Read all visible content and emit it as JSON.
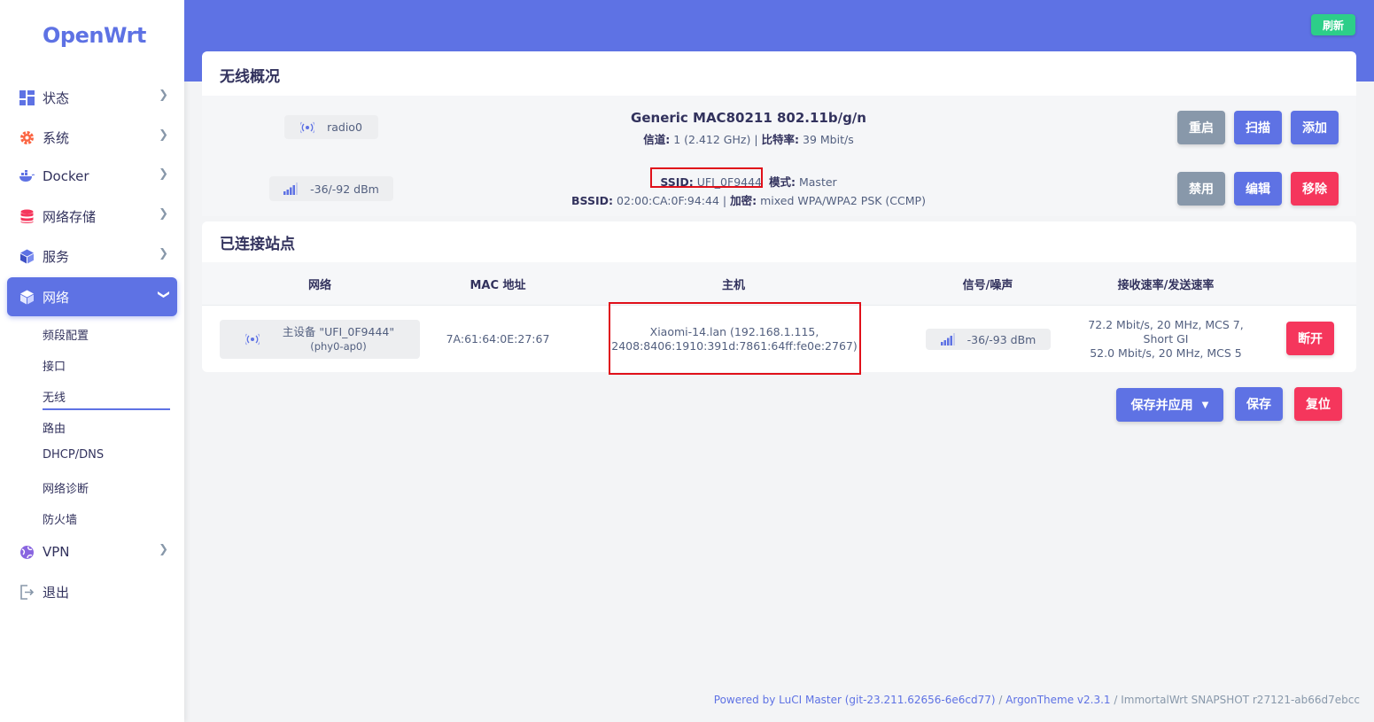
{
  "brand": "OpenWrt",
  "sidebar": {
    "items": [
      {
        "label": "状态",
        "icon": "dashboard-icon"
      },
      {
        "label": "系统",
        "icon": "gear-icon"
      },
      {
        "label": "Docker",
        "icon": "docker-icon"
      },
      {
        "label": "网络存储",
        "icon": "database-icon"
      },
      {
        "label": "服务",
        "icon": "cube-icon"
      },
      {
        "label": "网络",
        "icon": "cube-icon"
      },
      {
        "label": "VPN",
        "icon": "globe-icon"
      },
      {
        "label": "退出",
        "icon": "logout-icon"
      }
    ],
    "submenu": [
      "频段配置",
      "接口",
      "无线",
      "路由",
      "DHCP/DNS",
      "网络诊断",
      "防火墙"
    ],
    "active_submenu": "无线"
  },
  "header": {
    "refresh_label": "刷新"
  },
  "wireless_overview": {
    "title": "无线概况",
    "radio": {
      "name": "radio0",
      "model": "Generic MAC80211 802.11b/g/n",
      "channel_label": "信道:",
      "channel_value": "1 (2.412 GHz)",
      "bitrate_label": "比特率:",
      "bitrate_value": "39 Mbit/s",
      "buttons": {
        "restart": "重启",
        "scan": "扫描",
        "add": "添加"
      }
    },
    "network": {
      "signal": "-36/-92 dBm",
      "ssid_label": "SSID:",
      "ssid_value": "UFI_0F9444",
      "mode_label": "模式:",
      "mode_value": "Master",
      "bssid_label": "BSSID:",
      "bssid_value": "02:00:CA:0F:94:44",
      "encryption_label": "加密:",
      "encryption_value": "mixed WPA/WPA2 PSK (CCMP)",
      "separator": "|",
      "buttons": {
        "disable": "禁用",
        "edit": "编辑",
        "remove": "移除"
      }
    }
  },
  "connected_stations": {
    "title": "已连接站点",
    "columns": [
      "网络",
      "MAC 地址",
      "主机",
      "信号/噪声",
      "接收速率/发送速率"
    ],
    "rows": [
      {
        "network_line1": "主设备 \"UFI_0F9444\"",
        "network_line2": "(phy0-ap0)",
        "mac": "7A:61:64:0E:27:67",
        "host_line1": "Xiaomi-14.lan (192.168.1.115,",
        "host_line2": "2408:8406:1910:391d:7861:64ff:fe0e:2767)",
        "signal": "-36/-93 dBm",
        "rate_line1": "72.2 Mbit/s, 20 MHz, MCS 7,",
        "rate_line2": "Short GI",
        "rate_line3": "52.0 Mbit/s, 20 MHz, MCS 5",
        "disconnect": "断开"
      }
    ]
  },
  "actions": {
    "save_apply": "保存并应用",
    "save": "保存",
    "reset": "复位"
  },
  "footer": {
    "luci": "Powered by LuCI Master (git-23.211.62656-6e6cd77)",
    "sep": " / ",
    "theme": "ArgonTheme v2.3.1",
    "build": "ImmortalWrt SNAPSHOT r27121-ab66d7ebcc"
  },
  "colors": {
    "primary": "#5e72e4",
    "success": "#2dce89",
    "danger": "#f5365c",
    "muted": "#8898aa",
    "highlight": "#e0101a"
  }
}
